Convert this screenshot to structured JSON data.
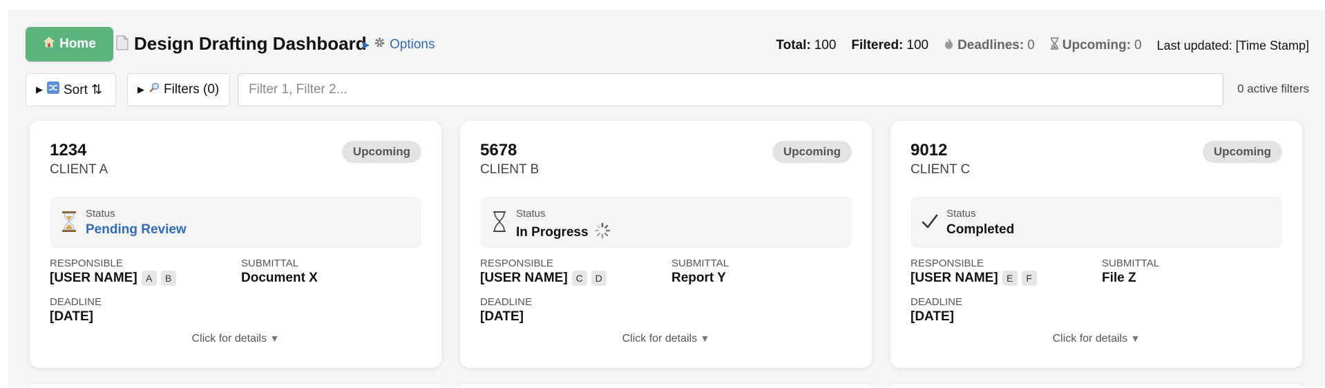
{
  "header": {
    "home_label": "Home",
    "title": "Design Drafting Dashboard",
    "options_label": "Options",
    "stats": {
      "total_label": "Total:",
      "total_value": "100",
      "filtered_label": "Filtered:",
      "filtered_value": "100",
      "deadlines_label": "Deadlines:",
      "deadlines_value": "0",
      "upcoming_label": "Upcoming:",
      "upcoming_value": "0",
      "last_updated": "Last updated: [Time Stamp]"
    }
  },
  "filterbar": {
    "sort_label": "Sort ⇅",
    "filters_label": "Filters (0)",
    "input_placeholder": "Filter 1, Filter 2...",
    "active_filters": "0 active filters"
  },
  "labels": {
    "status": "Status",
    "responsible": "RESPONSIBLE",
    "submittal": "SUBMITTAL",
    "deadline": "DEADLINE",
    "details": "Click for details"
  },
  "cards": [
    {
      "number": "1234",
      "client": "CLIENT A",
      "badge": "Upcoming",
      "status": "Pending Review",
      "status_icon": "hourglass-icon",
      "responsible": "[USER NAME]",
      "tags": [
        "A",
        "B"
      ],
      "submittal": "Document X",
      "deadline": "[DATE]"
    },
    {
      "number": "5678",
      "client": "CLIENT B",
      "badge": "Upcoming",
      "status": "In Progress",
      "status_icon": "hourglass-empty-icon",
      "responsible": "[USER NAME]",
      "tags": [
        "C",
        "D"
      ],
      "submittal": "Report Y",
      "deadline": "[DATE]"
    },
    {
      "number": "9012",
      "client": "CLIENT C",
      "badge": "Upcoming",
      "status": "Completed",
      "status_icon": "checkmark-icon",
      "responsible": "[USER NAME]",
      "tags": [
        "E",
        "F"
      ],
      "submittal": "File Z",
      "deadline": "[DATE]"
    }
  ],
  "colors": {
    "home_green": "#5bb47e",
    "link_blue": "#2f6bb8",
    "badge_bg": "#e3e3e5"
  }
}
